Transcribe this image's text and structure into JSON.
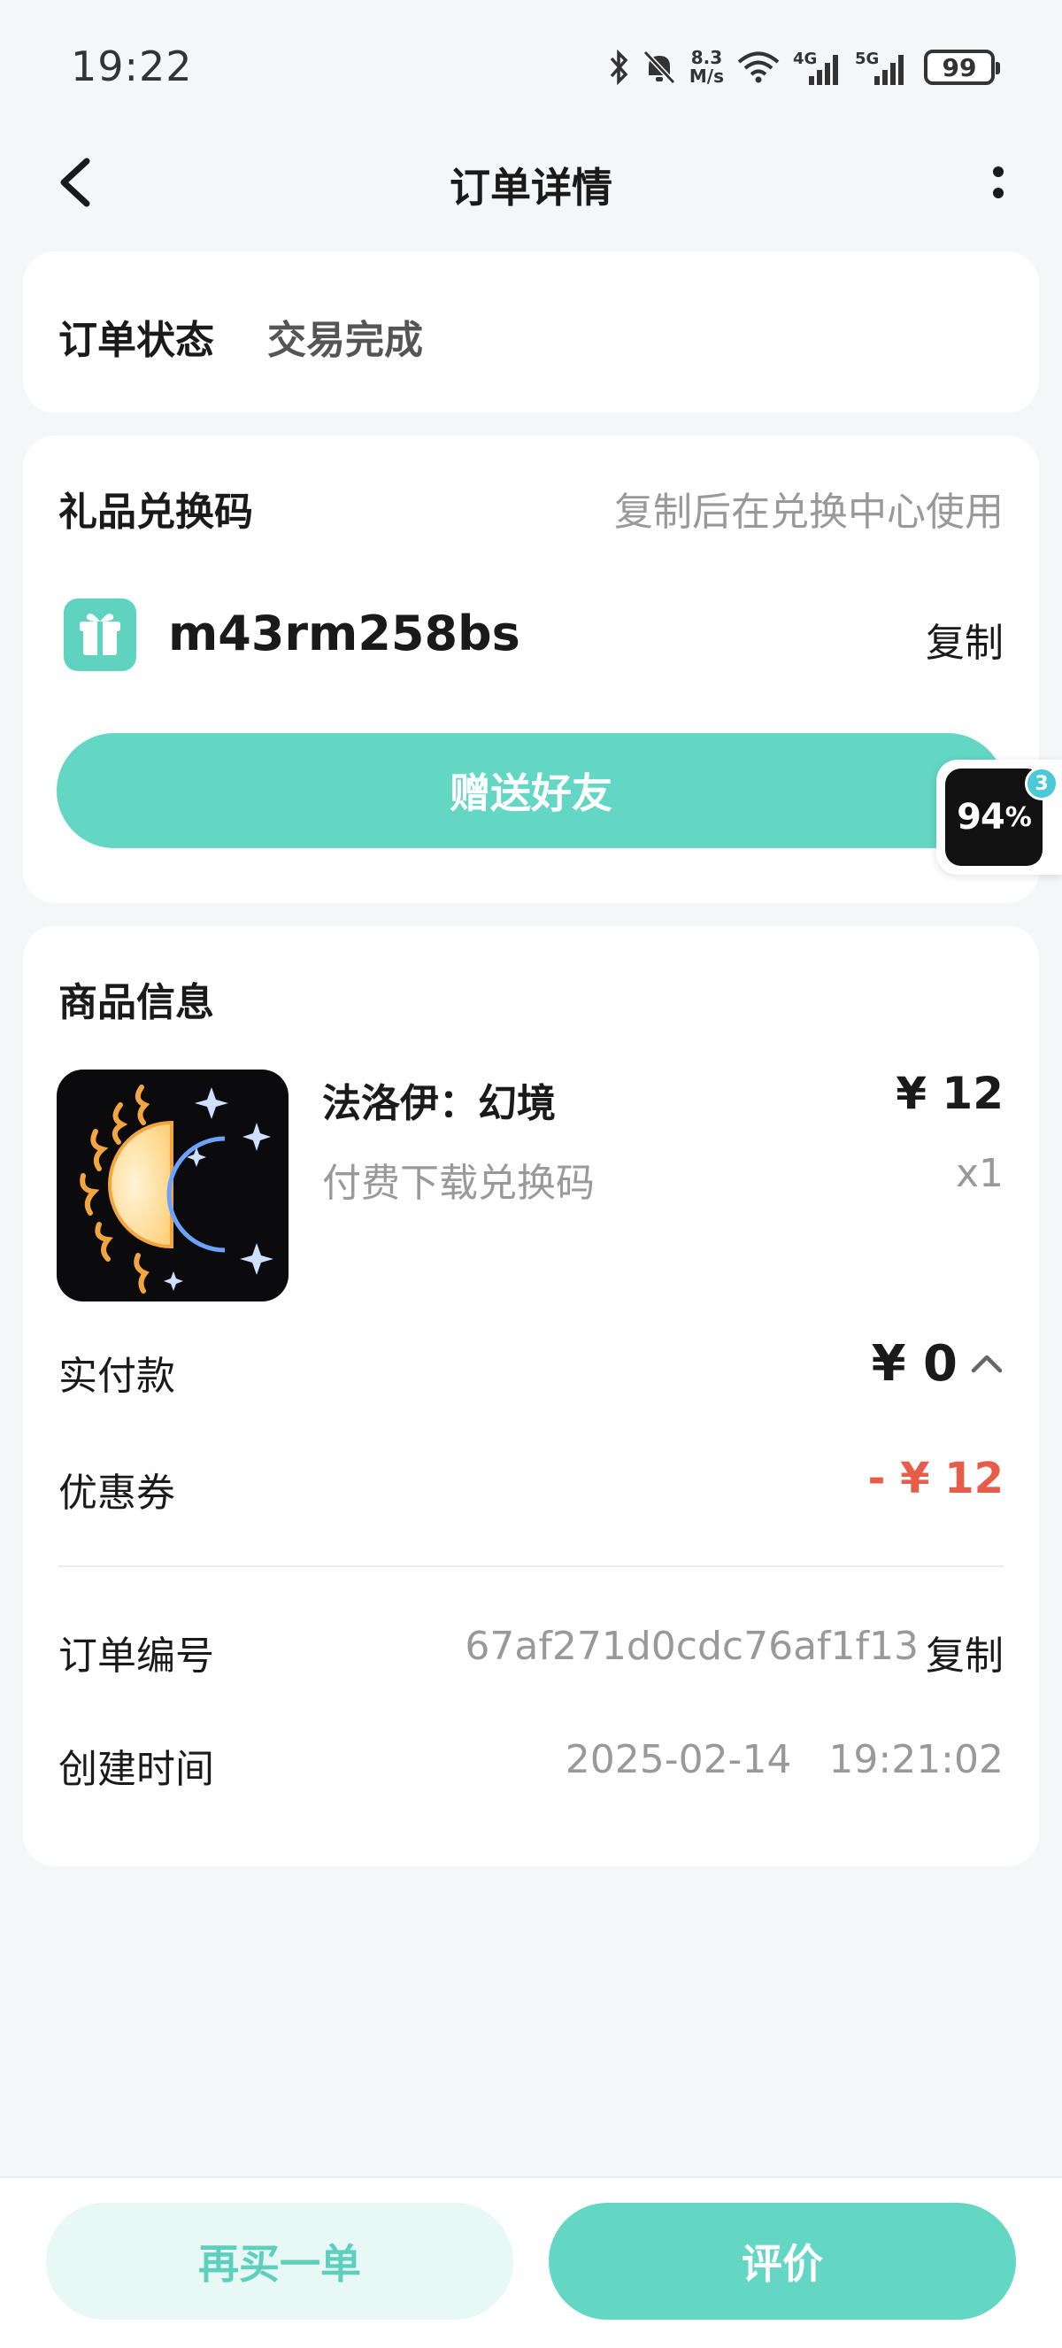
{
  "status_bar": {
    "time": "19:22",
    "net_speed_value": "8.3",
    "net_speed_unit": "M/s",
    "signal_4g": "4G",
    "signal_5g": "5G",
    "battery": "99",
    "icons": [
      "bluetooth-icon",
      "mute-icon",
      "wifi-icon",
      "signal-4g-icon",
      "signal-5g-icon",
      "battery-icon"
    ]
  },
  "nav": {
    "title": "订单详情"
  },
  "order_status": {
    "label": "订单状态",
    "value": "交易完成"
  },
  "gift": {
    "title": "礼品兑换码",
    "hint": "复制后在兑换中心使用",
    "code": "m43rm258bs",
    "copy_label": "复制",
    "send_button": "赠送好友",
    "icon": "gift-icon"
  },
  "product": {
    "title": "商品信息",
    "name": "法洛伊：幻境",
    "subtitle": "付费下载兑换码",
    "price": "¥ 12",
    "quantity": "x1",
    "paid_label": "实付款",
    "paid_value": "¥ 0",
    "coupon_label": "优惠券",
    "coupon_value": "- ¥ 12",
    "order_no_label": "订单编号",
    "order_no_value": "67af271d0cdc76af1f13",
    "order_copy_label": "复制",
    "created_label": "创建时间",
    "created_value": "2025-02-14   19:21:02"
  },
  "float_badge": {
    "value": "94",
    "unit": "%",
    "count": "3"
  },
  "bottom": {
    "rebuy_label": "再买一单",
    "review_label": "评价"
  },
  "colors": {
    "accent": "#63d6c4",
    "accent_light": "#e8f8f5",
    "discount": "#e85c4a",
    "background": "#f5f6f8"
  }
}
